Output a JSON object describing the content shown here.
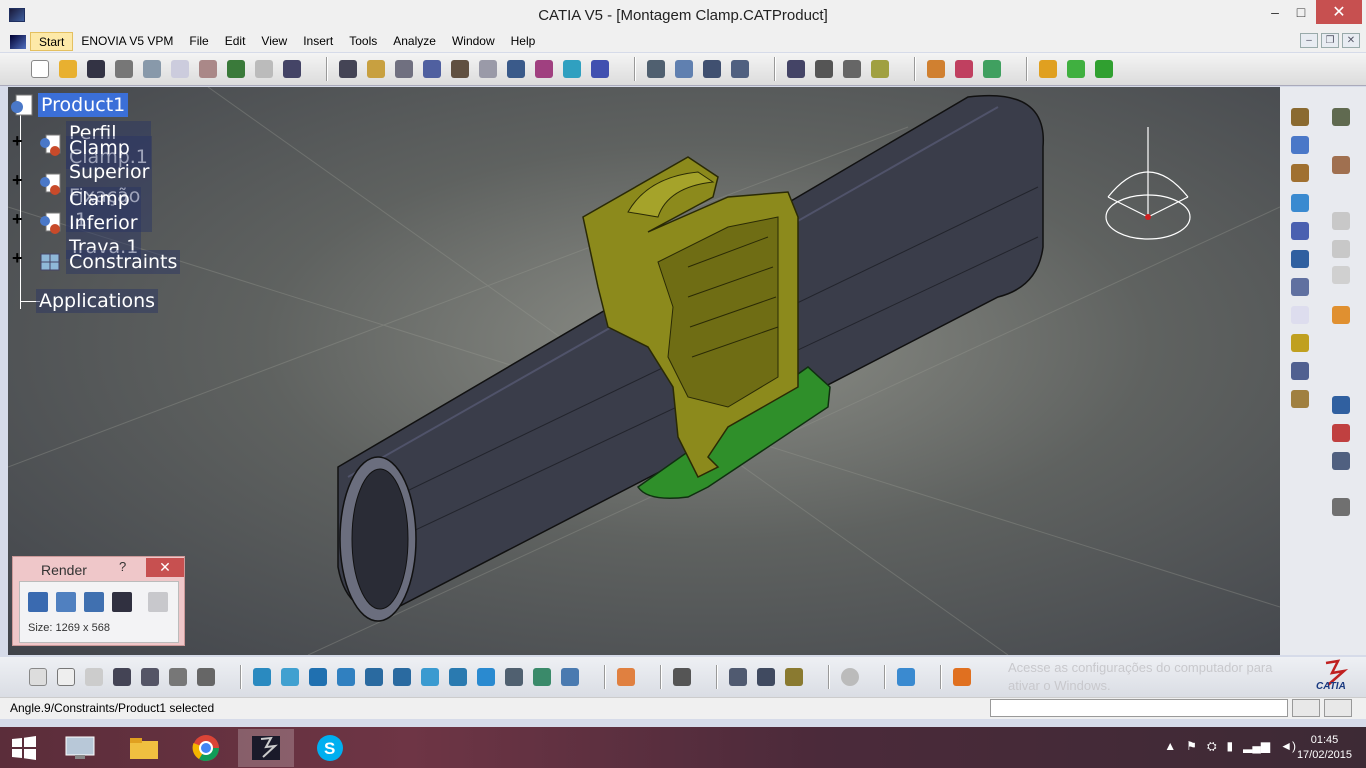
{
  "window": {
    "title": "CATIA V5 - [Montagem Clamp.CATProduct]",
    "minimize": "–",
    "maximize": "□",
    "close": "✕"
  },
  "menu": {
    "items": [
      "Start",
      "ENOVIA V5 VPM",
      "File",
      "Edit",
      "View",
      "Insert",
      "Tools",
      "Analyze",
      "Window",
      "Help"
    ]
  },
  "tree": {
    "root": "Product1",
    "children": [
      "Perfil Clamp.1",
      "Clamp Superior Fixação .1",
      "Clamp Inferior Trava.1",
      "Constraints"
    ],
    "applications": "Applications"
  },
  "render_panel": {
    "title": "Render",
    "help": "?",
    "close": "✕",
    "size_label": "Size: 1269 x 568"
  },
  "status": {
    "text": "Angle.9/Constraints/Product1 selected"
  },
  "watermark": {
    "line1": "Acesse as configurações do computador para",
    "line2": "ativar o Windows."
  },
  "logo": "CATIA",
  "taskbar": {
    "time": "01:45",
    "date": "17/02/2015"
  },
  "colors": {
    "tree_label_bg": "#3b6fd8",
    "clamp_yellow": "#8c8a1c",
    "clamp_green": "#2f8f2a",
    "tube": "#3a3d4a"
  }
}
